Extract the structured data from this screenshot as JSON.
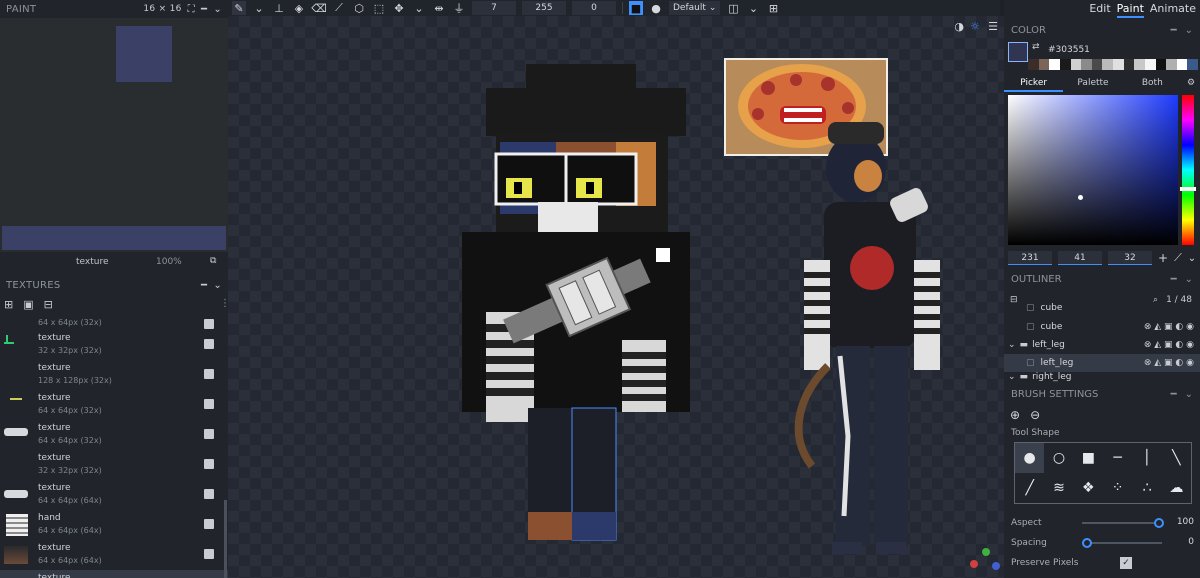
{
  "toolbar": {
    "size": "7",
    "opacity": "255",
    "softness": "0",
    "blend_mode": "Default"
  },
  "paint_panel": {
    "title": "PAINT",
    "resolution": "16 × 16",
    "texture_name": "texture",
    "zoom": "100%"
  },
  "textures_panel": {
    "title": "TEXTURES",
    "items": [
      {
        "name": "",
        "meta": "64 x 64px (32x)"
      },
      {
        "name": "texture",
        "meta": "32 x 32px (32x)"
      },
      {
        "name": "texture",
        "meta": "128 x 128px (32x)"
      },
      {
        "name": "texture",
        "meta": "64 x 64px (32x)"
      },
      {
        "name": "texture",
        "meta": "64 x 64px (32x)"
      },
      {
        "name": "texture",
        "meta": "32 x 32px (32x)"
      },
      {
        "name": "texture",
        "meta": "64 x 64px (64x)"
      },
      {
        "name": "hand",
        "meta": "64 x 64px (64x)"
      },
      {
        "name": "texture",
        "meta": "64 x 64px (64x)"
      },
      {
        "name": "texture",
        "meta": ""
      }
    ]
  },
  "modes": {
    "edit": "Edit",
    "paint": "Paint",
    "animate": "Animate"
  },
  "color_panel": {
    "title": "COLOR",
    "hex": "#303551",
    "accent": "#303551",
    "tabs": {
      "picker": "Picker",
      "palette": "Palette",
      "both": "Both"
    },
    "r": "231",
    "g": "41",
    "b": "32",
    "palette_colors": [
      "#3a2d2a",
      "#7a6558",
      "#ffffff",
      "#1a1a1a",
      "#d0d0d0",
      "#8a8a8a",
      "#4a4a4a",
      "#bbbbbb",
      "#e0e0e0",
      "#2e2e2e",
      "#c8c8c8",
      "#f5f5f5",
      "#101010",
      "#b0b0b0",
      "#ffffff",
      "#3b5a8a"
    ]
  },
  "outliner": {
    "title": "OUTLINER",
    "count": "1 / 48",
    "rows": [
      {
        "label": "cube",
        "type": "cube"
      },
      {
        "label": "cube",
        "type": "cube"
      },
      {
        "label": "left_leg",
        "type": "group"
      },
      {
        "label": "left_leg",
        "type": "cube"
      },
      {
        "label": "right_leg",
        "type": "group"
      }
    ]
  },
  "brush_settings": {
    "title": "BRUSH SETTINGS",
    "tool_shape_label": "Tool Shape",
    "aspect_label": "Aspect",
    "aspect_value": "100",
    "spacing_label": "Spacing",
    "spacing_value": "0",
    "preserve_pixels_label": "Preserve Pixels"
  }
}
